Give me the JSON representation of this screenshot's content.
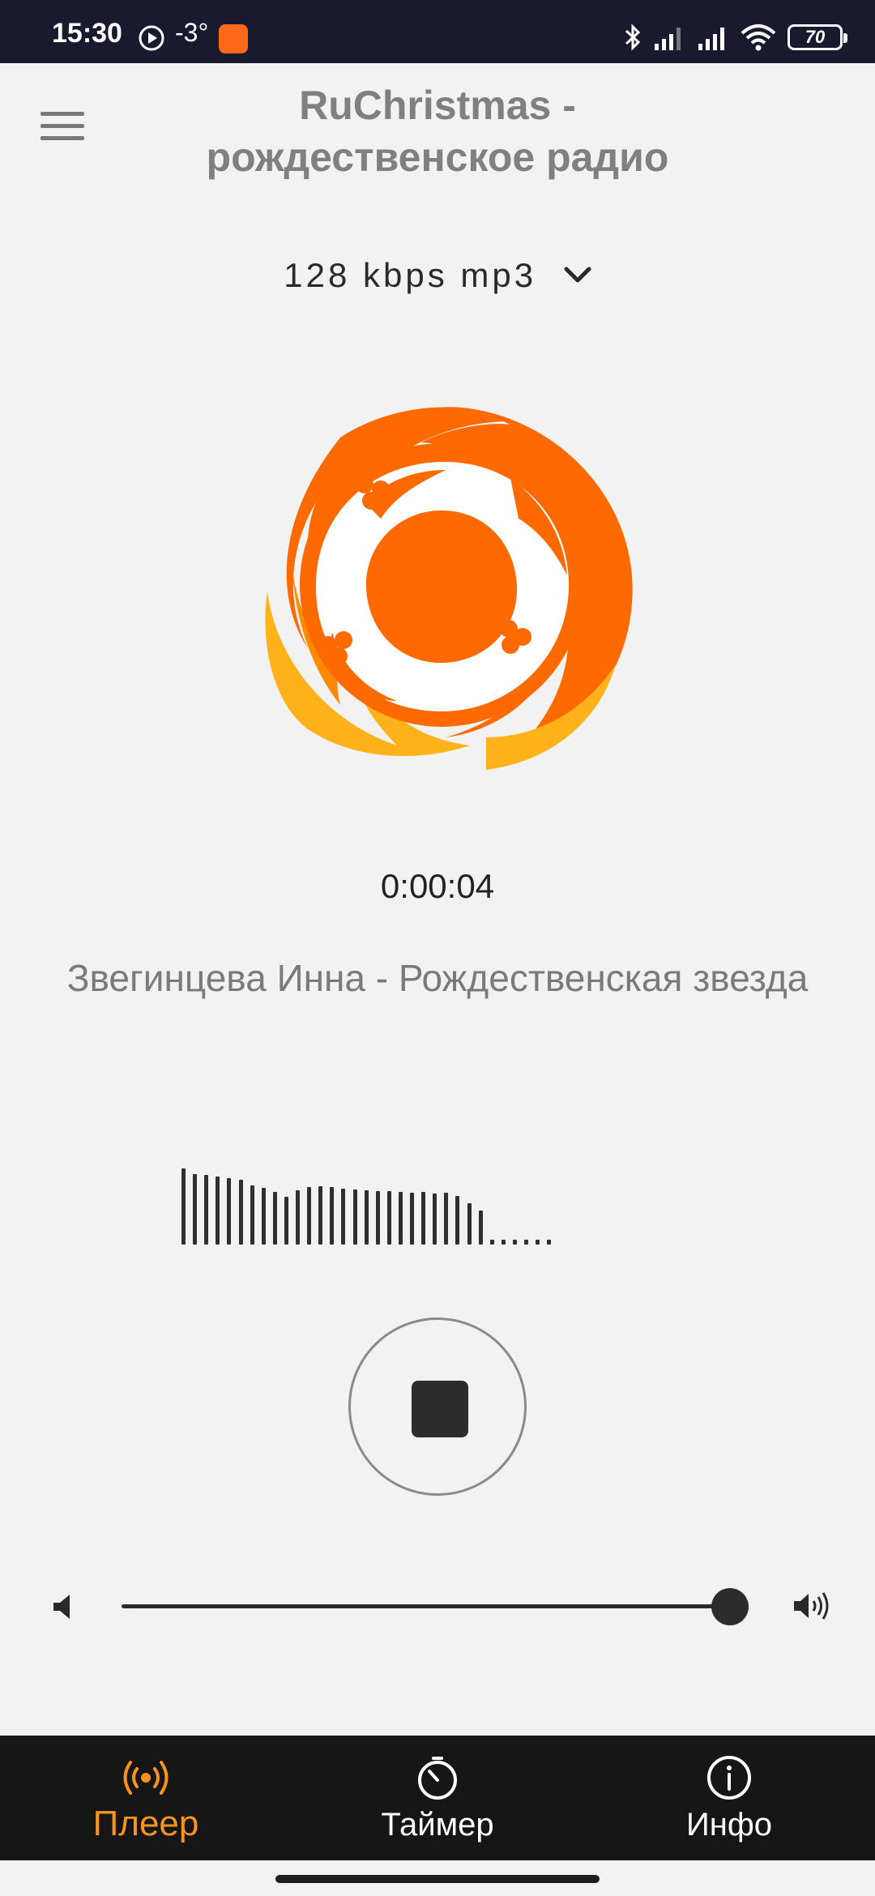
{
  "status_bar": {
    "time": "15:30",
    "temperature": "-3°",
    "battery": "70"
  },
  "header": {
    "title_line1": "RuChristmas -",
    "title_line2": "рождественское радио"
  },
  "stream": {
    "bitrate_label": "128 kbps mp3"
  },
  "player": {
    "elapsed": "0:00:04",
    "track": "Звегинцева Инна - Рождественская звезда",
    "volume_fraction": 0.97,
    "visualizer_levels": [
      1.0,
      0.93,
      0.91,
      0.89,
      0.87,
      0.85,
      0.78,
      0.74,
      0.69,
      0.63,
      0.71,
      0.75,
      0.77,
      0.76,
      0.73,
      0.72,
      0.71,
      0.7,
      0.7,
      0.69,
      0.68,
      0.69,
      0.67,
      0.68,
      0.64,
      0.54,
      0.45,
      0.06,
      0.06,
      0.06,
      0.06,
      0.06,
      0.06
    ]
  },
  "colors": {
    "accent": "#f7941d",
    "logo_orange": "#ff6a00",
    "logo_yellow": "#ffb21a",
    "nav_bg": "#161616",
    "page_bg": "#f2f2f2"
  },
  "nav": {
    "items": [
      {
        "label": "Плеер",
        "icon": "broadcast-icon",
        "active": true
      },
      {
        "label": "Таймер",
        "icon": "timer-icon",
        "active": false
      },
      {
        "label": "Инфо",
        "icon": "info-icon",
        "active": false
      }
    ]
  }
}
